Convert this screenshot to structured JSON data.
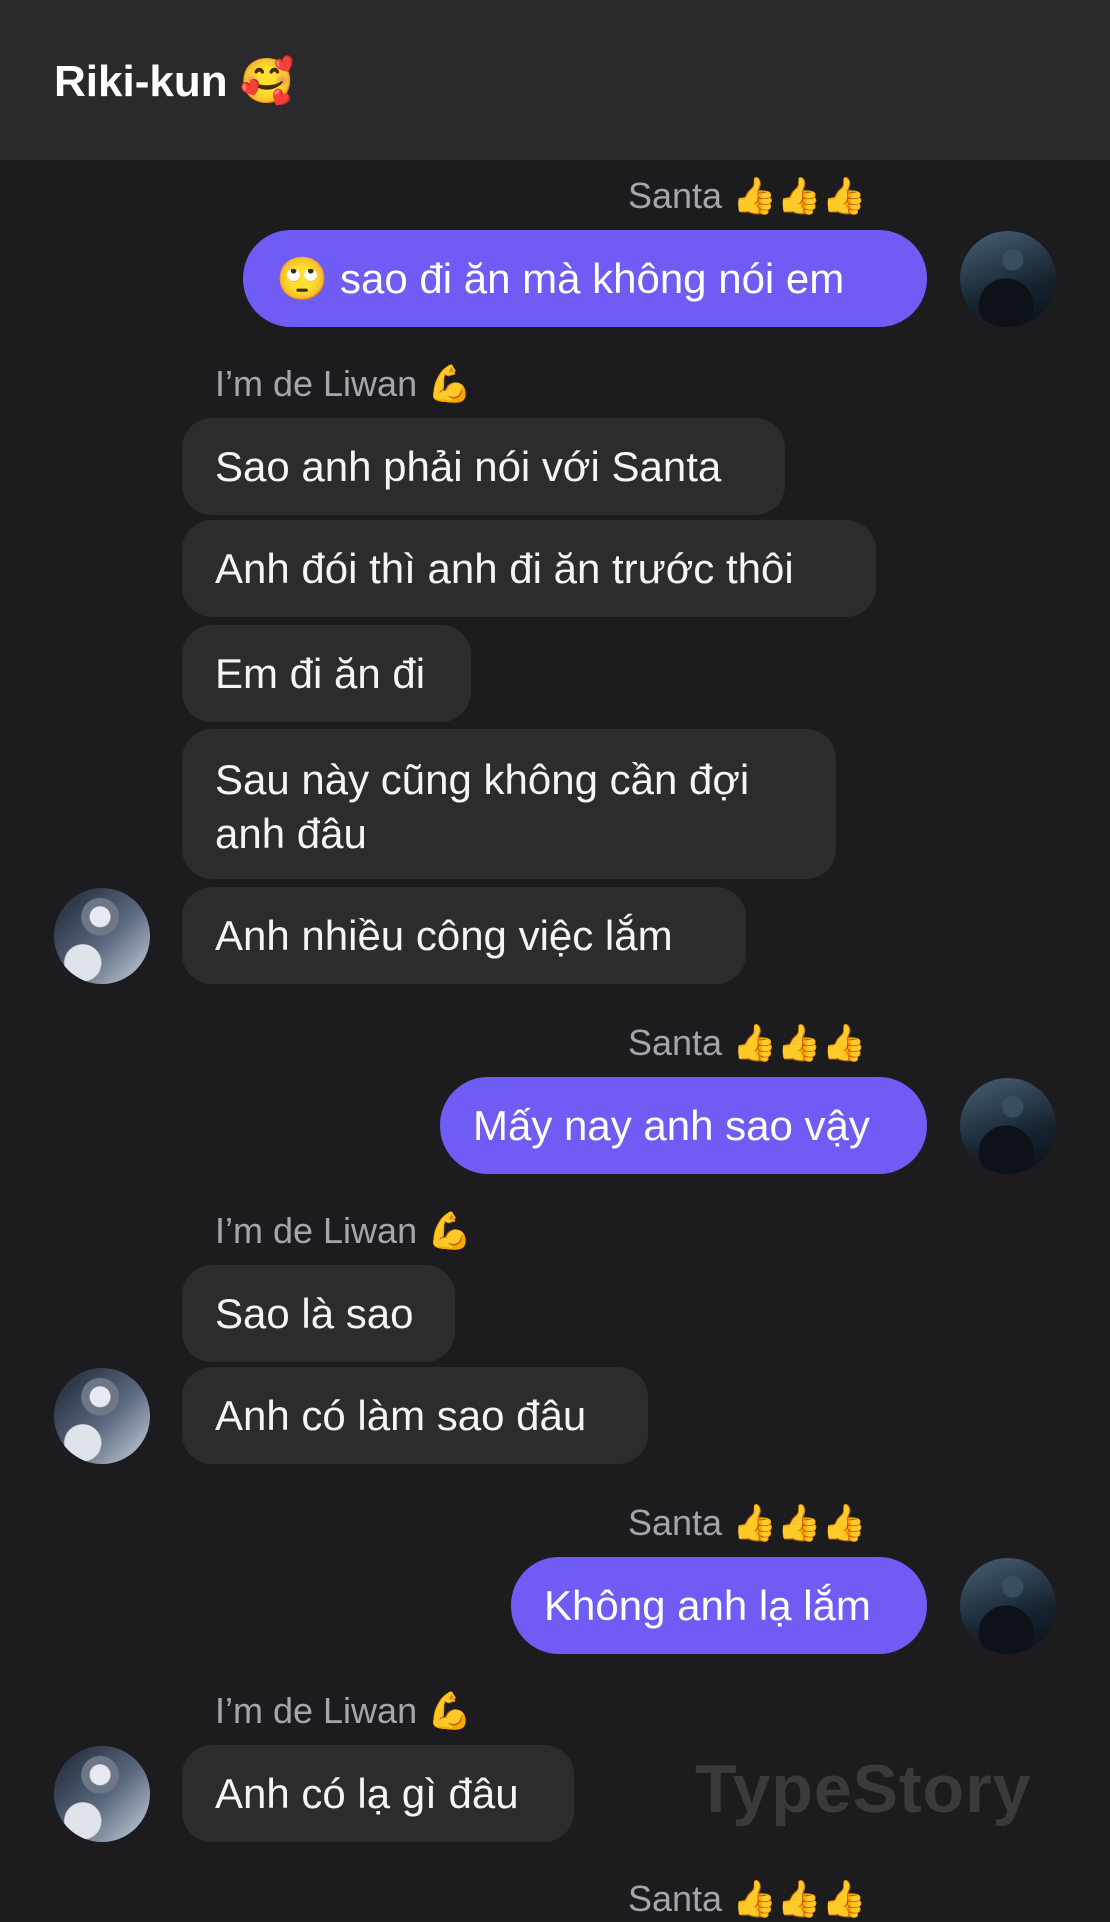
{
  "header": {
    "title": "Riki-kun",
    "title_emoji": "🥰"
  },
  "names": {
    "self": "Santa",
    "self_emoji": "👍👍👍",
    "other": "I’m de Liwan",
    "other_emoji": "💪"
  },
  "messages": {
    "m1": "🙄 sao đi ăn mà không nói em",
    "m2": "Sao anh phải nói với Santa",
    "m3": "Anh đói thì anh đi ăn trước thôi",
    "m4": "Em đi ăn đi",
    "m5": "Sau này cũng không cần đợi anh đâu",
    "m6": "Anh nhiều công việc lắm",
    "m7": "Mấy nay anh sao vậy",
    "m8": "Sao là sao",
    "m9": "Anh có làm sao đâu",
    "m10": "Không anh lạ lắm",
    "m11": "Anh có lạ gì đâu"
  },
  "watermark": "TypeStory",
  "colors": {
    "outgoing_bubble": "#6e5cf4",
    "incoming_bubble": "#2c2c2e",
    "background": "#1c1c1e",
    "header": "#2a2a2c"
  }
}
